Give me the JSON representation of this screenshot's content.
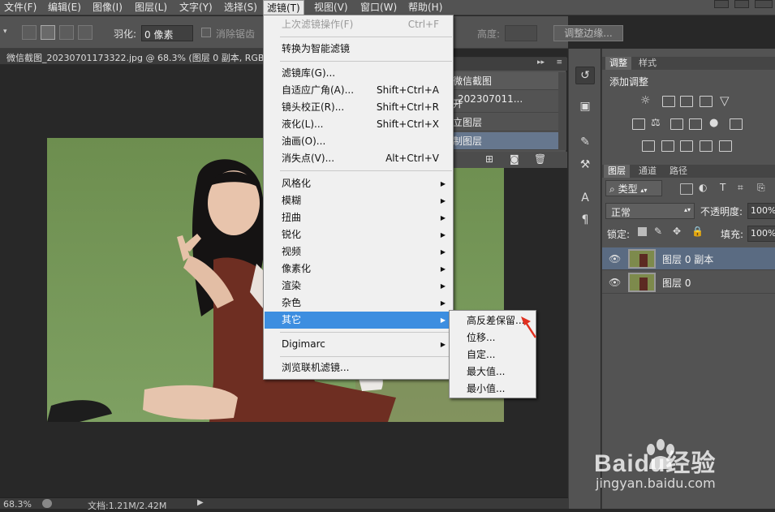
{
  "menubar": {
    "items": [
      "文件(F)",
      "编辑(E)",
      "图像(I)",
      "图层(L)",
      "文字(Y)",
      "选择(S)",
      "滤镜(T)",
      "视图(V)",
      "窗口(W)",
      "帮助(H)"
    ],
    "window_controls": [
      "minimize",
      "restore",
      "close"
    ]
  },
  "options_bar": {
    "feather_label": "羽化:",
    "feather_value": "0 像素",
    "antialias_label": "消除锯齿",
    "height_label": "高度:",
    "refine_edge_button": "调整边缘..."
  },
  "document_tab": {
    "title": "微信截图_20230701173322.jpg @ 68.3% (图层 0 副本, RGB"
  },
  "status_bar": {
    "zoom": "68.3%",
    "doc_info": "文档:1.21M/2.42M"
  },
  "filter_menu": {
    "items": [
      {
        "label": "上次滤镜操作(F)",
        "shortcut": "Ctrl+F",
        "disabled": true
      },
      {
        "label": "转换为智能滤镜"
      },
      {
        "label": "滤镜库(G)..."
      },
      {
        "label": "自适应广角(A)...",
        "shortcut": "Shift+Ctrl+A"
      },
      {
        "label": "镜头校正(R)...",
        "shortcut": "Shift+Ctrl+R"
      },
      {
        "label": "液化(L)...",
        "shortcut": "Shift+Ctrl+X"
      },
      {
        "label": "油画(O)..."
      },
      {
        "label": "消失点(V)...",
        "shortcut": "Alt+Ctrl+V"
      },
      {
        "label": "风格化",
        "submenu": true
      },
      {
        "label": "模糊",
        "submenu": true
      },
      {
        "label": "扭曲",
        "submenu": true
      },
      {
        "label": "锐化",
        "submenu": true
      },
      {
        "label": "视频",
        "submenu": true
      },
      {
        "label": "像素化",
        "submenu": true
      },
      {
        "label": "渲染",
        "submenu": true
      },
      {
        "label": "杂色",
        "submenu": true
      },
      {
        "label": "其它",
        "submenu": true,
        "highlighted": true
      },
      {
        "label": "Digimarc",
        "submenu": true
      },
      {
        "label": "浏览联机滤镜..."
      }
    ]
  },
  "other_submenu": {
    "items": [
      "高反差保留...",
      "位移...",
      "自定...",
      "最大值...",
      "最小值..."
    ]
  },
  "history_panel": {
    "doc_name": "微信截图_202307011...",
    "rows": [
      "开",
      "立图层",
      "制图层"
    ]
  },
  "adjustments_panel": {
    "tabs": [
      "调整",
      "样式"
    ],
    "heading": "添加调整"
  },
  "layers_panel": {
    "tabs": [
      "图层",
      "通道",
      "路径"
    ],
    "filter_type": "类型",
    "blend_mode": "正常",
    "opacity_label": "不透明度:",
    "opacity_value": "100%",
    "lock_label": "锁定:",
    "fill_label": "填充:",
    "fill_value": "100%",
    "layers": [
      {
        "name": "图层 0 副本",
        "selected": true
      },
      {
        "name": "图层 0",
        "selected": false
      }
    ]
  },
  "watermark": {
    "brand": "Baidu经验",
    "url": "jingyan.baidu.com"
  },
  "colors": {
    "menu_highlight": "#3d8ee0",
    "panel_bg": "#535353",
    "canvas_bg": "#282828",
    "layer_selected": "#5a6b82",
    "arrow_red": "#e03020"
  }
}
